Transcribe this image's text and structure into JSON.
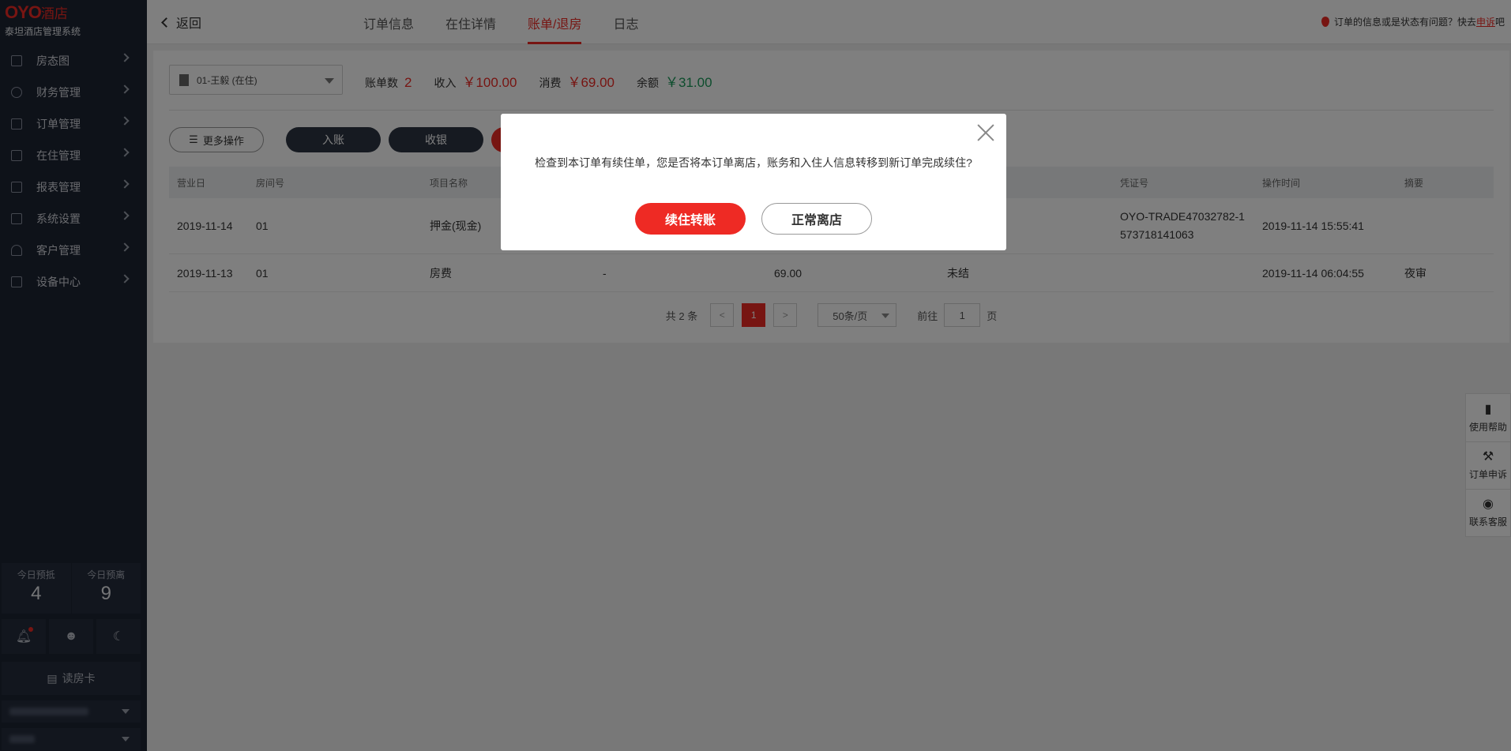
{
  "brand": {
    "logo": "OYO",
    "logo_suffix": "酒店",
    "subtitle": "泰坦酒店管理系统"
  },
  "sidebar": {
    "items": [
      {
        "label": "房态图",
        "icon": "grid-icon"
      },
      {
        "label": "财务管理",
        "icon": "money-icon"
      },
      {
        "label": "订单管理",
        "icon": "order-icon"
      },
      {
        "label": "在住管理",
        "icon": "bed-icon"
      },
      {
        "label": "报表管理",
        "icon": "chart-icon"
      },
      {
        "label": "系统设置",
        "icon": "settings-icon"
      },
      {
        "label": "客户管理",
        "icon": "user-icon"
      },
      {
        "label": "设备中心",
        "icon": "device-icon"
      }
    ],
    "stats": [
      {
        "label": "今日预抵",
        "value": "4"
      },
      {
        "label": "今日预离",
        "value": "9"
      }
    ],
    "card_button": "读房卡"
  },
  "topbar": {
    "back_label": "返回",
    "tabs": [
      {
        "label": "订单信息",
        "active": false
      },
      {
        "label": "在住详情",
        "active": false
      },
      {
        "label": "账单/退房",
        "active": true
      },
      {
        "label": "日志",
        "active": false
      }
    ],
    "notice_text": "订单的信息或是状态有问题？快去",
    "notice_link": "申诉",
    "notice_tail": "吧"
  },
  "billing": {
    "guest_select": "01-王毅 (在住)",
    "bill_count_label": "账单数",
    "bill_count": "2",
    "income_label": "收入",
    "income": "￥100.00",
    "consume_label": "消费",
    "consume": "￥69.00",
    "balance_label": "余额",
    "balance": "￥31.00"
  },
  "actions": {
    "more": "更多操作",
    "post": "入账",
    "cashier": "收银"
  },
  "table": {
    "headers": [
      "营业日",
      "房间号",
      "项目名称",
      "",
      "",
      "",
      "凭证号",
      "操作时间",
      "摘要"
    ],
    "rows": [
      {
        "date": "2019-11-14",
        "room": "01",
        "item": "押金(现金)",
        "c4": "",
        "c5": "",
        "c6": "",
        "voucher": "OYO-TRADE47032782-1573718141063",
        "voucher_l1": "OYO-TRADE47032782-1",
        "voucher_l2": "573718141063",
        "time": "2019-11-14 15:55:41",
        "note": ""
      },
      {
        "date": "2019-11-13",
        "room": "01",
        "item": "房费",
        "c4": "-",
        "c5": "69.00",
        "c6": "未结",
        "voucher": "",
        "voucher_l1": "",
        "voucher_l2": "",
        "time": "2019-11-14 06:04:55",
        "note": "夜审"
      }
    ]
  },
  "pager": {
    "total": "共 2 条",
    "current": "1",
    "page_size": "50条/页",
    "goto_label": "前往",
    "goto_value": "1",
    "goto_suffix": "页"
  },
  "floatbar": [
    {
      "label": "使用帮助",
      "icon": "book-icon"
    },
    {
      "label": "订单申诉",
      "icon": "gavel-icon"
    },
    {
      "label": "联系客服",
      "icon": "headset-icon"
    }
  ],
  "modal": {
    "message": "检查到本订单有续住单，您是否将本订单离店，账务和入住人信息转移到新订单完成续住?",
    "primary": "续住转账",
    "secondary": "正常离店"
  },
  "colors": {
    "accent": "#ee2a24",
    "sidebar_bg": "#1d2433",
    "balance": "#1b9a5b"
  }
}
